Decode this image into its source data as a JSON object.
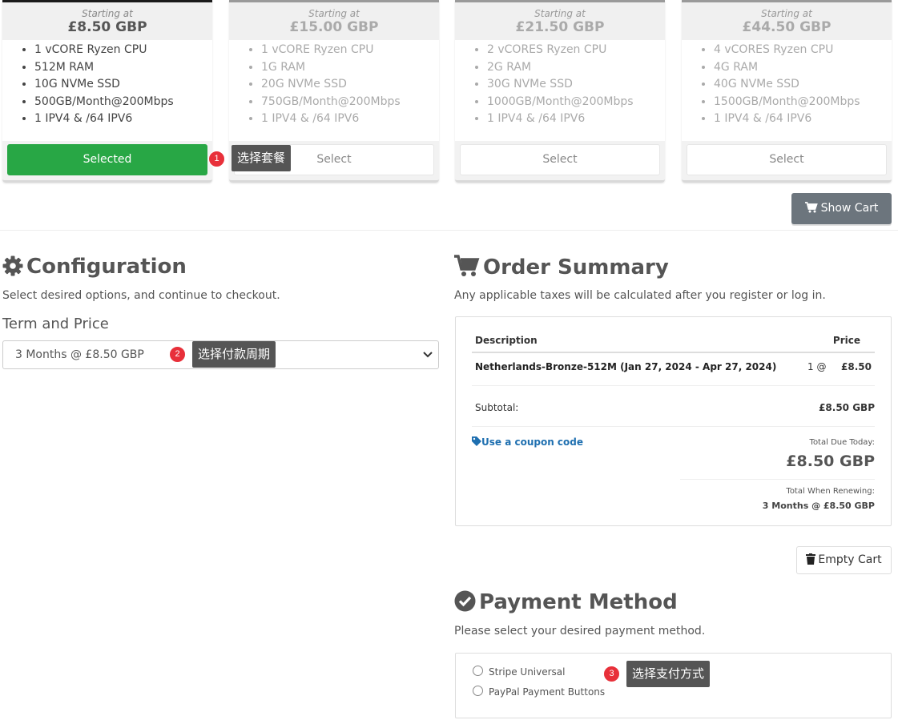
{
  "plans": [
    {
      "starting": "Starting at",
      "price": "£8.50 GBP",
      "features": [
        "1 vCORE Ryzen CPU",
        "512M RAM",
        "10G NVMe SSD",
        "500GB/Month@200Mbps",
        "1 IPV4 & /64 IPV6"
      ],
      "button": "Selected",
      "selected": true
    },
    {
      "starting": "Starting at",
      "price": "£15.00 GBP",
      "features": [
        "1 vCORE Ryzen CPU",
        "1G RAM",
        "20G NVMe SSD",
        "750GB/Month@200Mbps",
        "1 IPV4 & /64 IPV6"
      ],
      "button": "Select",
      "selected": false
    },
    {
      "starting": "Starting at",
      "price": "£21.50 GBP",
      "features": [
        "2 vCORES Ryzen CPU",
        "2G RAM",
        "30G NVMe SSD",
        "1000GB/Month@200Mbps",
        "1 IPV4 & /64 IPV6"
      ],
      "button": "Select",
      "selected": false
    },
    {
      "starting": "Starting at",
      "price": "£44.50 GBP",
      "features": [
        "4 vCORES Ryzen CPU",
        "4G RAM",
        "40G NVMe SSD",
        "1500GB/Month@200Mbps",
        "1 IPV4 & /64 IPV6"
      ],
      "button": "Select",
      "selected": false
    }
  ],
  "annotations": {
    "step1": {
      "number": "1",
      "text": "选择套餐"
    },
    "step2": {
      "number": "2",
      "text": "选择付款周期"
    },
    "step3": {
      "number": "3",
      "text": "选择支付方式"
    }
  },
  "show_cart": "Show Cart",
  "configuration": {
    "title": "Configuration",
    "subtitle": "Select desired options, and continue to checkout.",
    "term_label": "Term and Price",
    "term_value": "3 Months @ £8.50 GBP"
  },
  "order_summary": {
    "title": "Order Summary",
    "subtitle": "Any applicable taxes will be calculated after you register or log in.",
    "col_description": "Description",
    "col_price": "Price",
    "item_name": "Netherlands-Bronze-512M (Jan 27, 2024 - Apr 27, 2024)",
    "item_qty": "1 @",
    "item_price": "£8.50",
    "subtotal_label": "Subtotal:",
    "subtotal_value": "£8.50 GBP",
    "coupon_link": "Use a coupon code",
    "total_due_label": "Total Due Today:",
    "total_due_value": "£8.50 GBP",
    "renew_label": "Total When Renewing:",
    "renew_value": "3 Months @ £8.50 GBP"
  },
  "empty_cart": "Empty Cart",
  "payment": {
    "title": "Payment Method",
    "subtitle": "Please select your desired payment method.",
    "options": [
      "Stripe Universal",
      "PayPal Payment Buttons"
    ]
  },
  "colors": {
    "success": "#28a745",
    "secondary": "#6c757d",
    "link": "#1e6fb0",
    "annotation": "#e8303a"
  }
}
